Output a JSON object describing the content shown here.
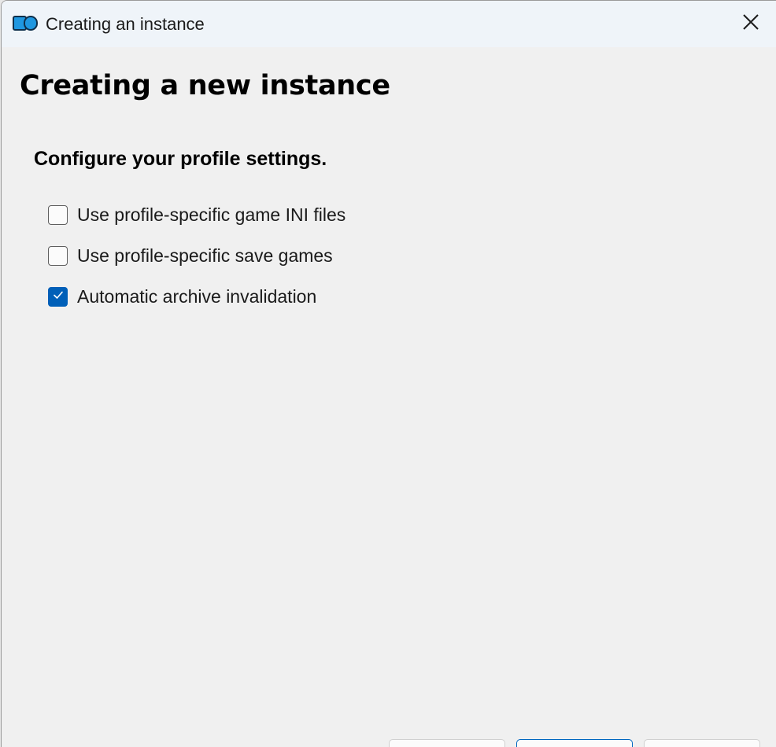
{
  "window": {
    "title": "Creating an instance",
    "close_icon": "close-icon",
    "app_icon": "mod-organizer-icon"
  },
  "page": {
    "title": "Creating a new instance",
    "heading": "Configure your profile settings."
  },
  "options": [
    {
      "label": "Use profile-specific game INI files",
      "checked": false
    },
    {
      "label": "Use profile-specific save games",
      "checked": false
    },
    {
      "label": "Automatic archive invalidation",
      "checked": true
    }
  ],
  "colors": {
    "accent": "#005fb8",
    "titlebar_bg": "#eff4f9",
    "window_bg": "#f0f0f0"
  }
}
